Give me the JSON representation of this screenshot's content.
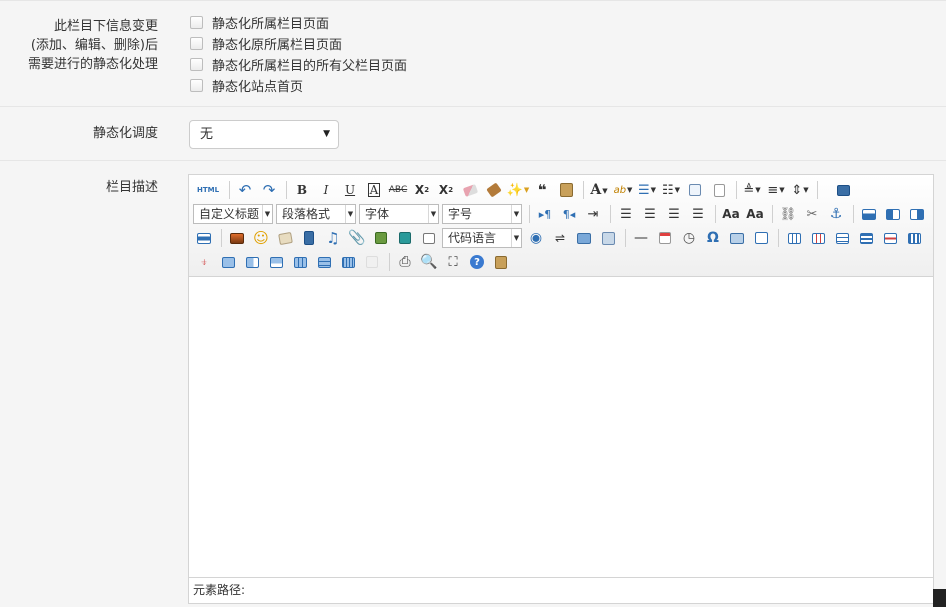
{
  "form": {
    "static_change": {
      "label_lines": [
        "此栏目下信息变更",
        "(添加、编辑、删除)后",
        "需要进行的静态化处理"
      ],
      "options": [
        {
          "label": "静态化所属栏目页面",
          "checked": false
        },
        {
          "label": "静态化原所属栏目页面",
          "checked": false
        },
        {
          "label": "静态化所属栏目的所有父栏目页面",
          "checked": false
        },
        {
          "label": "静态化站点首页",
          "checked": false
        }
      ]
    },
    "schedule": {
      "label": "静态化调度",
      "selected": "无"
    },
    "description": {
      "label": "栏目描述"
    }
  },
  "editor": {
    "toolbar": {
      "html_label": "HTML",
      "custom_title": "自定义标题",
      "paragraph": "段落格式",
      "font_family": "字体",
      "font_size": "字号",
      "code_lang": "代码语言"
    },
    "statusbar": {
      "path_label": "元素路径:"
    }
  },
  "colors": {
    "background": "#f5f5f5",
    "border": "#e6e6e6",
    "toolbar_blue": "#2f6fb3"
  }
}
